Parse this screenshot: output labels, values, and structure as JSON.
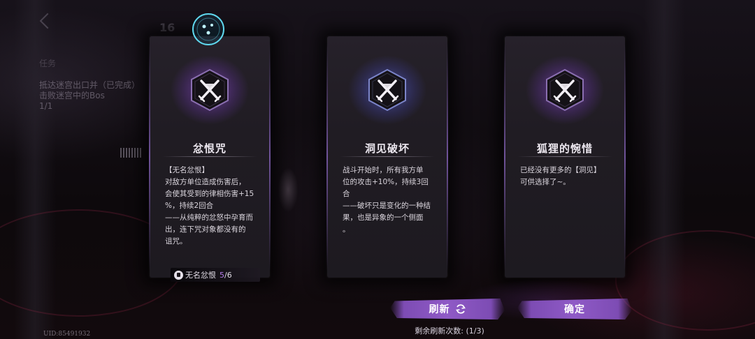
{
  "background": {
    "hud_lines": [
      "任务",
      "抵达迷宫出口并（已完成）",
      "击败迷宫中的Bos",
      "1/1"
    ],
    "level_badge": "16"
  },
  "cards": [
    {
      "title": "忿恨咒",
      "description": "【无名忿恨】\n对敌方单位造成伤害后，\n会使其受到的律相伤害+15\n%，持续2回合\n——从纯粹的忿怒中孕育而\n出，连下咒对象都没有的\n诅咒。",
      "glow": "purple",
      "emblem_icon": "crossed-swords-icon",
      "counter": {
        "label": "无名忿恨",
        "current": "5",
        "max": "/6"
      }
    },
    {
      "title": "洞见破坏",
      "description": "战斗开始时，所有我方单\n位的攻击+10%，持续3回\n合\n——破坏只是变化的一种结\n果，也是异象的一个侧面\n。",
      "glow": "blue",
      "emblem_icon": "crossed-swords-icon"
    },
    {
      "title": "狐狸的惋惜",
      "description": "已经没有更多的【洞见】\n可供选择了~。",
      "glow": "purple",
      "emblem_icon": "crossed-swords-icon"
    }
  ],
  "buttons": {
    "refresh_label": "刷新",
    "confirm_label": "确定"
  },
  "refresh_note": "剩余刷新次数: (1/3)",
  "uid": "UID:85491932",
  "colors": {
    "accent_purple": "#8f5ac6",
    "counter_highlight": "#b17be6"
  }
}
